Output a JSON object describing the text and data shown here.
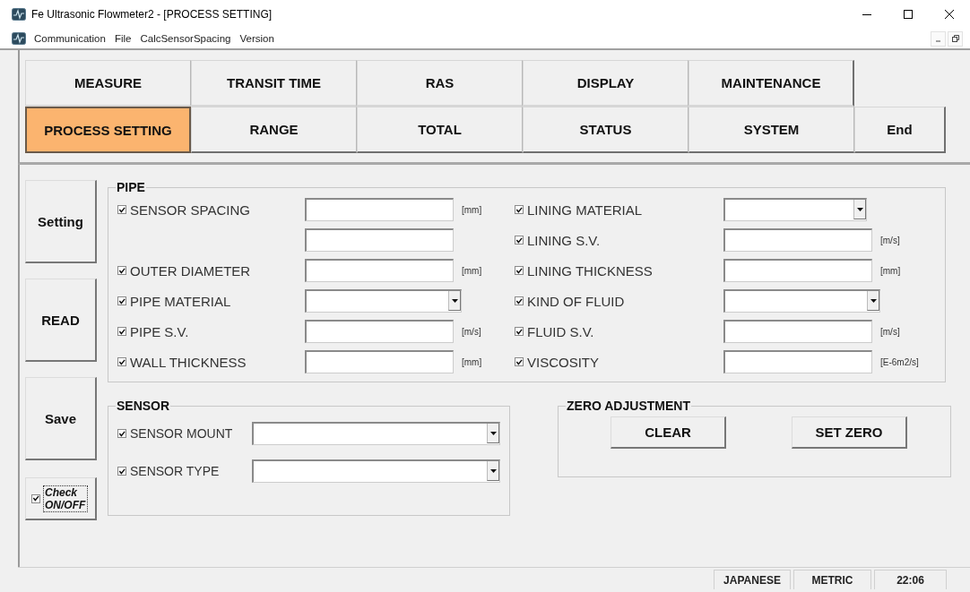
{
  "window": {
    "title": "Fe Ultrasonic Flowmeter2 - [PROCESS SETTING]"
  },
  "menu": [
    "Communication",
    "File",
    "CalcSensorSpacing",
    "Version"
  ],
  "nav_rows": [
    [
      {
        "label": "MEASURE",
        "selected": false
      },
      {
        "label": "TRANSIT TIME",
        "selected": false
      },
      {
        "label": "RAS",
        "selected": false
      },
      {
        "label": "DISPLAY",
        "selected": false
      },
      {
        "label": "MAINTENANCE",
        "selected": false
      }
    ],
    [
      {
        "label": "PROCESS SETTING",
        "selected": true
      },
      {
        "label": "RANGE",
        "selected": false
      },
      {
        "label": "TOTAL",
        "selected": false
      },
      {
        "label": "STATUS",
        "selected": false
      },
      {
        "label": "SYSTEM",
        "selected": false
      },
      {
        "label": "End",
        "selected": false
      }
    ]
  ],
  "actions": [
    "Setting",
    "READ",
    "Save"
  ],
  "check_toggle": {
    "label": "Check ON/OFF",
    "checked": true
  },
  "pipe": {
    "title": "PIPE",
    "columns": [
      [
        {
          "label": "SENSOR SPACING",
          "checked": true,
          "kind": "text",
          "unit": "[mm]"
        },
        {
          "kind": "text"
        },
        {
          "label": "OUTER DIAMETER",
          "checked": true,
          "kind": "text",
          "unit": "[mm]"
        },
        {
          "label": "PIPE MATERIAL",
          "checked": true,
          "kind": "select"
        },
        {
          "label": "PIPE S.V.",
          "checked": true,
          "kind": "text",
          "unit": "[m/s]"
        },
        {
          "label": "WALL THICKNESS",
          "checked": true,
          "kind": "text",
          "unit": "[mm]"
        }
      ],
      [
        {
          "label": "LINING MATERIAL",
          "checked": true,
          "kind": "select"
        },
        {
          "label": "LINING S.V.",
          "checked": true,
          "kind": "text",
          "unit": "[m/s]"
        },
        {
          "label": "LINING THICKNESS",
          "checked": true,
          "kind": "text",
          "unit": "[mm]"
        },
        {
          "label": "KIND OF FLUID",
          "checked": true,
          "kind": "select"
        },
        {
          "label": "FLUID S.V.",
          "checked": true,
          "kind": "text",
          "unit": "[m/s]"
        },
        {
          "label": "VISCOSITY",
          "checked": true,
          "kind": "text",
          "unit": "[E-6m2/s]"
        }
      ]
    ]
  },
  "sensor": {
    "title": "SENSOR",
    "rows": [
      {
        "label": "SENSOR MOUNT",
        "checked": true,
        "kind": "select"
      },
      {
        "label": "SENSOR TYPE",
        "checked": true,
        "kind": "select"
      }
    ]
  },
  "zero_adjustment": {
    "title": "ZERO ADJUSTMENT",
    "buttons": [
      "CLEAR",
      "SET ZERO"
    ]
  },
  "status_bar": [
    "JAPANESE",
    "METRIC",
    "22:06"
  ]
}
